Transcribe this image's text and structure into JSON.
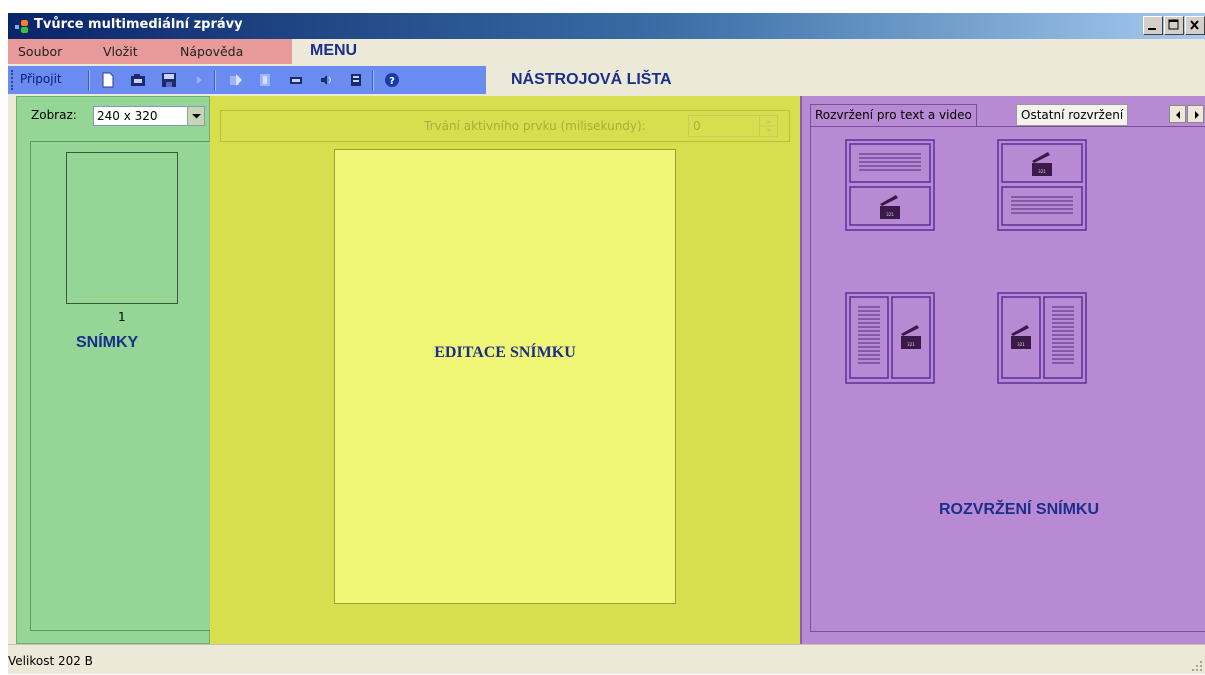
{
  "window": {
    "title": "Tvůrce multimediální zprávy"
  },
  "menu": {
    "items": [
      "Soubor",
      "Vložit",
      "Nápověda"
    ],
    "caption": "MENU"
  },
  "toolbar": {
    "connect_label": "Připojit",
    "caption": "NÁSTROJOVÁ LIŠTA",
    "icons": [
      "new-icon",
      "open-icon",
      "save-icon",
      "play-icon",
      "insert-image-icon",
      "text-icon",
      "video-icon",
      "sound-icon",
      "slide-icon",
      "help-icon"
    ]
  },
  "slides_panel": {
    "view_label": "Zobraz:",
    "view_value": "240 x 320",
    "slide_number": "1",
    "caption": "SNÍMKY"
  },
  "editor": {
    "duration_label": "Trvání aktivního prvku (milisekundy):",
    "duration_value": "0",
    "caption": "EDITACE SNÍMKU"
  },
  "layouts_panel": {
    "tabs": [
      "Rozvržení pro text a video",
      "Ostatní rozvržení"
    ],
    "caption": "ROZVRŽENÍ SNÍMKU"
  },
  "statusbar": {
    "text": "Velikost 202 B"
  },
  "colors": {
    "menu_highlight": "#e89a9a",
    "toolbar_highlight": "#6a8cf0",
    "slides_panel": "#95d595",
    "editor_panel": "#d7df4e",
    "slide_canvas": "#f0f676",
    "layouts_panel": "#b98ad4",
    "caption_text": "#1a2f8a"
  }
}
